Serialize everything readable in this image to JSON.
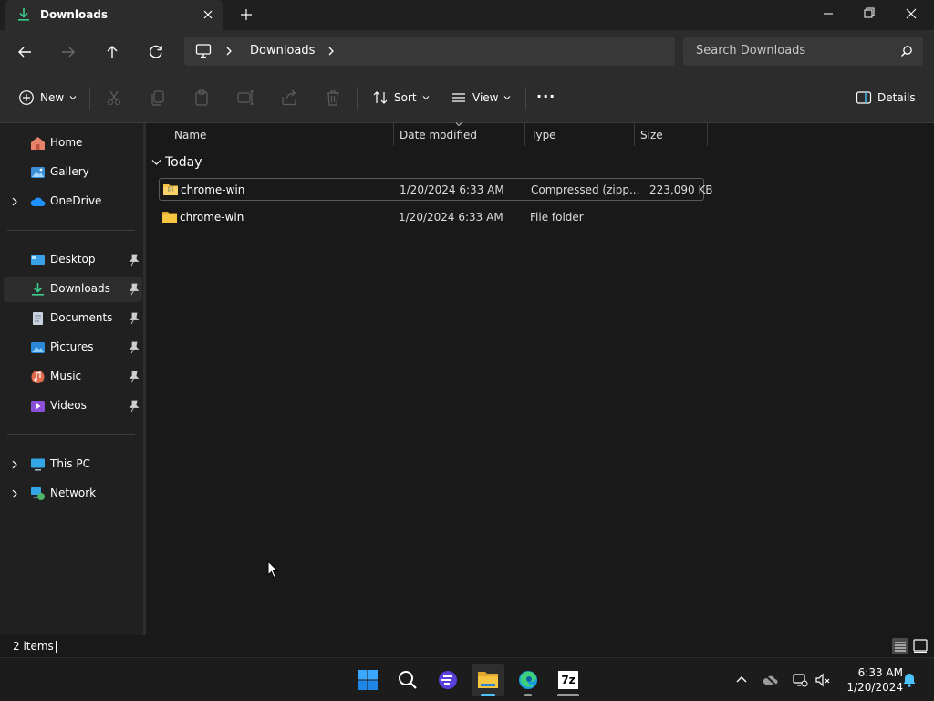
{
  "window": {
    "tab_title": "Downloads",
    "new_tab_symbol": "+"
  },
  "address_bar": {
    "root_icon": "this-pc-icon",
    "path": [
      "Downloads"
    ],
    "search_placeholder": "Search Downloads"
  },
  "command_bar": {
    "new_label": "New",
    "sort_label": "Sort",
    "view_label": "View",
    "more_label": "···",
    "details_label": "Details"
  },
  "sidebar": {
    "items": [
      {
        "label": "Home",
        "icon": "home-icon",
        "expandable": false,
        "pinned": false
      },
      {
        "label": "Gallery",
        "icon": "gallery-icon",
        "expandable": false,
        "pinned": false
      },
      {
        "label": "OneDrive",
        "icon": "onedrive-icon",
        "expandable": true,
        "pinned": false
      },
      {
        "label": "Desktop",
        "icon": "desktop-icon",
        "expandable": false,
        "pinned": true
      },
      {
        "label": "Downloads",
        "icon": "downloads-icon",
        "expandable": false,
        "pinned": true,
        "selected": true
      },
      {
        "label": "Documents",
        "icon": "documents-icon",
        "expandable": false,
        "pinned": true
      },
      {
        "label": "Pictures",
        "icon": "pictures-icon",
        "expandable": false,
        "pinned": true
      },
      {
        "label": "Music",
        "icon": "music-icon",
        "expandable": false,
        "pinned": true
      },
      {
        "label": "Videos",
        "icon": "videos-icon",
        "expandable": false,
        "pinned": true
      },
      {
        "label": "This PC",
        "icon": "this-pc-icon",
        "expandable": true,
        "pinned": false
      },
      {
        "label": "Network",
        "icon": "network-icon",
        "expandable": true,
        "pinned": false
      }
    ]
  },
  "file_list": {
    "columns": [
      "Name",
      "Date modified",
      "Type",
      "Size"
    ],
    "group": "Today",
    "rows": [
      {
        "name": "chrome-win",
        "date": "1/20/2024 6:33 AM",
        "type": "Compressed (zipp...",
        "size": "223,090 KB",
        "icon": "zip-folder-icon"
      },
      {
        "name": "chrome-win",
        "date": "1/20/2024 6:33 AM",
        "type": "File folder",
        "size": "",
        "icon": "folder-icon"
      }
    ]
  },
  "status_bar": {
    "item_count": "2 items"
  },
  "taskbar": {
    "time": "6:33 AM",
    "date": "1/20/2024",
    "apps": [
      "start-icon",
      "search-icon",
      "app-icon",
      "file-explorer-icon",
      "edge-icon",
      "7zip-icon"
    ],
    "sevenzip_label": "7z"
  },
  "colors": {
    "accent": "#4cc2ff",
    "folder": "#f5c542",
    "download_green": "#3ccf8e"
  }
}
